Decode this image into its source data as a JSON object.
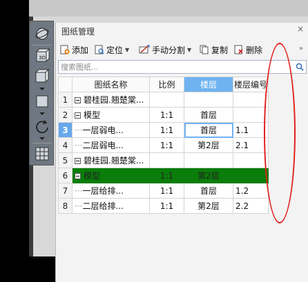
{
  "panel": {
    "title": "图纸管理",
    "close": "×",
    "more": "»"
  },
  "actions": {
    "add": "添加",
    "locate": "定位",
    "split": "手动分割",
    "copy": "复制",
    "delete": "删除"
  },
  "search": {
    "placeholder": "搜索图纸..."
  },
  "table": {
    "headers": [
      "",
      "图纸名称",
      "比例",
      "楼层",
      "楼层编号"
    ],
    "rows": [
      {
        "num": "1",
        "name": "碧桂园.翘楚棠...",
        "scale": "",
        "floor": "",
        "code": ""
      },
      {
        "num": "2",
        "name": "模型",
        "scale": "1:1",
        "floor": "首层",
        "code": ""
      },
      {
        "num": "3",
        "name": "一层弱电...",
        "scale": "1:1",
        "floor": "首层",
        "code": "1.1"
      },
      {
        "num": "4",
        "name": "二层弱电...",
        "scale": "1:1",
        "floor": "第2层",
        "code": "2.1"
      },
      {
        "num": "5",
        "name": "碧桂园.翘楚棠...",
        "scale": "",
        "floor": "",
        "code": ""
      },
      {
        "num": "6",
        "name": "模型",
        "scale": "1:1",
        "floor": "第2层",
        "code": ""
      },
      {
        "num": "7",
        "name": "一层给排...",
        "scale": "1:1",
        "floor": "首层",
        "code": "1.2"
      },
      {
        "num": "8",
        "name": "二层给排...",
        "scale": "1:1",
        "floor": "第2层",
        "code": "2.2"
      }
    ]
  },
  "colors": {
    "selected_header": "#6fb3f0",
    "highlight_row": "#0a7d0a",
    "annotation": "#e0201c"
  }
}
